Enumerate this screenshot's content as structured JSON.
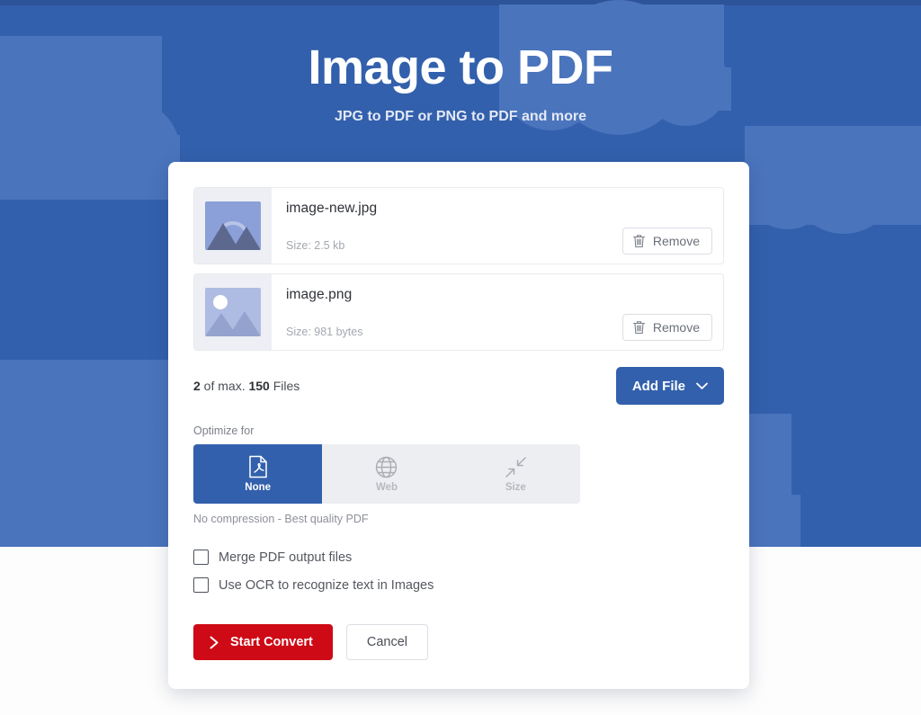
{
  "header": {
    "title": "Image to PDF",
    "subtitle": "JPG to PDF or PNG to PDF and more"
  },
  "files": [
    {
      "name": "image-new.jpg",
      "size_label": "Size: 2.5 kb",
      "remove_label": "Remove",
      "thumb_kind": "mountain-arc"
    },
    {
      "name": "image.png",
      "size_label": "Size: 981 bytes",
      "remove_label": "Remove",
      "thumb_kind": "mountain-sun"
    }
  ],
  "counter": {
    "current": "2",
    "middle": " of max. ",
    "max": "150",
    "suffix": " Files"
  },
  "add_file": {
    "label": "Add File",
    "chevron": "chevron-down-icon"
  },
  "optimize": {
    "label": "Optimize for",
    "options": [
      {
        "label": "None",
        "icon": "pdf-file-icon",
        "selected": true
      },
      {
        "label": "Web",
        "icon": "globe-icon",
        "selected": false
      },
      {
        "label": "Size",
        "icon": "compress-arrows-icon",
        "selected": false
      }
    ],
    "hint": "No compression - Best quality PDF"
  },
  "checkboxes": [
    {
      "label": "Merge PDF output files",
      "checked": false
    },
    {
      "label": "Use OCR to recognize text in Images",
      "checked": false
    }
  ],
  "actions": {
    "start_label": "Start Convert",
    "start_icon": "chevron-right-icon",
    "cancel_label": "Cancel"
  },
  "colors": {
    "hero_blue": "#3360ac",
    "cloud_blue": "#4a74bc",
    "primary": "#3360ac",
    "danger": "#ce0a16",
    "segment_bg": "#eceef1"
  }
}
